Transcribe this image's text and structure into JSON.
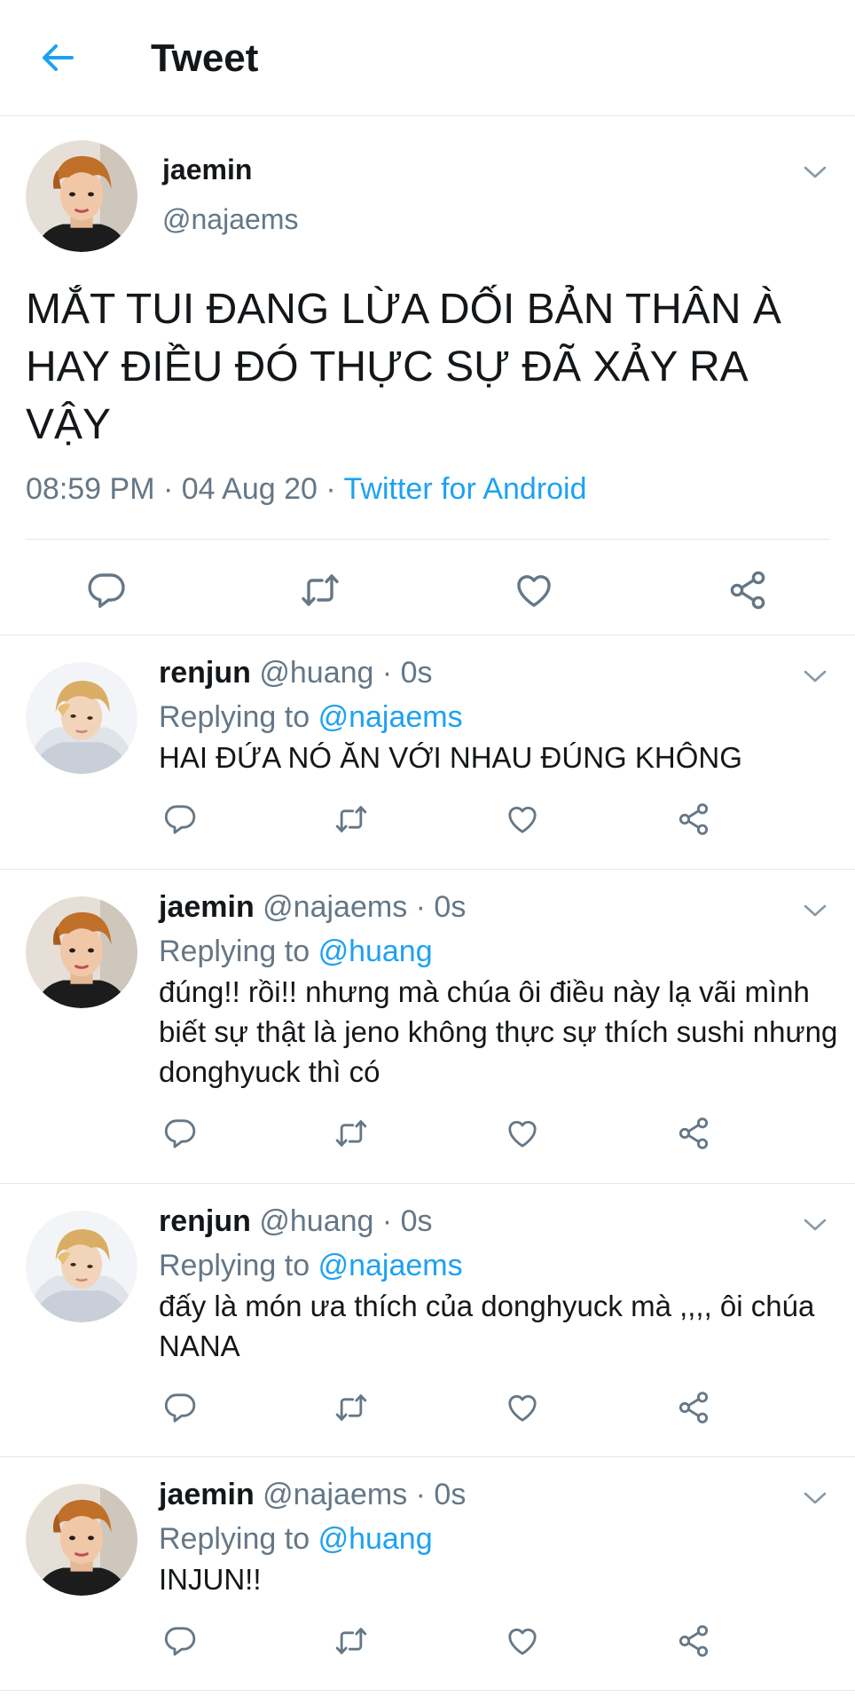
{
  "header": {
    "title": "Tweet",
    "back_icon": "arrow-left-icon"
  },
  "colors": {
    "accent": "#1da1f2",
    "secondary_text": "#657786",
    "divider": "#e1e8ed",
    "text": "#14171a"
  },
  "main_tweet": {
    "name": "jaemin",
    "handle": "@najaems",
    "text": "MẮT TUI ĐANG LỪA DỐI BẢN THÂN À HAY ĐIỀU ĐÓ THỰC SỰ ĐÃ XẢY RA VẬY",
    "time": "08:59 PM",
    "sep1": " · ",
    "date": "04 Aug 20",
    "sep2": " · ",
    "source": "Twitter for Android"
  },
  "replying_label": "Replying to",
  "replies": [
    {
      "name": "renjun",
      "handle": "@huang",
      "dot": " · ",
      "time": "0s",
      "replying_to": "@najaems",
      "text": "HAI ĐỨA NÓ ĂN VỚI NHAU ĐÚNG KHÔNG"
    },
    {
      "name": "jaemin",
      "handle": "@najaems",
      "dot": " · ",
      "time": "0s",
      "replying_to": "@huang",
      "text": "đúng!! rồi!! nhưng mà chúa ôi điều này lạ vãi mình biết sự thật là jeno không thực sự thích sushi nhưng donghyuck thì có"
    },
    {
      "name": "renjun",
      "handle": "@huang",
      "dot": " · ",
      "time": "0s",
      "replying_to": "@najaems",
      "text": "đấy là món ưa thích của donghyuck mà ,,,, ôi chúa NANA"
    },
    {
      "name": "jaemin",
      "handle": "@najaems",
      "dot": " · ",
      "time": "0s",
      "replying_to": "@huang",
      "text": "INJUN!!"
    }
  ],
  "action_icons": [
    "reply-icon",
    "retweet-icon",
    "like-icon",
    "share-icon"
  ]
}
